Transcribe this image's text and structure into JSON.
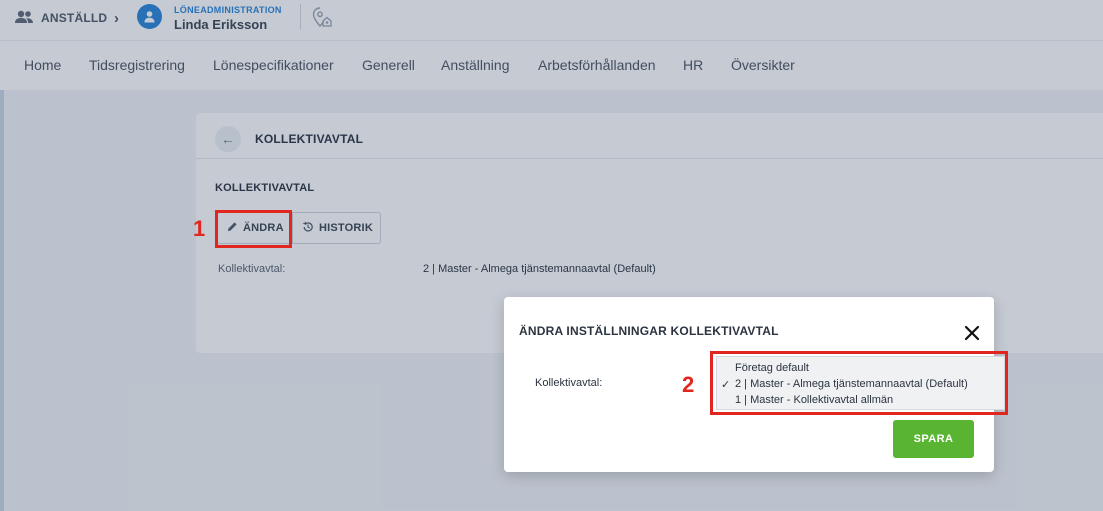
{
  "topbar": {
    "employee_label": "ANSTÄLLD",
    "app_label": "LÖNEADMINISTRATION",
    "user_name": "Linda Eriksson"
  },
  "nav": {
    "items": [
      "Home",
      "Tidsregistrering",
      "Lönespecifikationer",
      "Generell",
      "Anställning",
      "Arbetsförhållanden",
      "HR",
      "Översikter"
    ]
  },
  "card": {
    "title": "KOLLEKTIVAVTAL",
    "section_title": "KOLLEKTIVAVTAL",
    "edit_label": "ÄNDRA",
    "history_label": "HISTORIK",
    "field_label": "Kollektivavtal:",
    "field_value": "2 | Master - Almega tjänstemannaavtal (Default)"
  },
  "modal": {
    "title": "ÄNDRA INSTÄLLNINGAR KOLLEKTIVAVTAL",
    "field_label": "Kollektivavtal:",
    "options": [
      "Företag default",
      "2 | Master - Almega tjänstemannaavtal (Default)",
      "1 | Master - Kollektivavtal allmän"
    ],
    "selected_index": 1,
    "check_mark": "✓",
    "save_label": "SPARA"
  },
  "annotations": [
    "1",
    "2"
  ],
  "colors": {
    "accent_blue": "#2a86d9",
    "save_green": "#59b431",
    "annotation_red": "#e0261f"
  }
}
